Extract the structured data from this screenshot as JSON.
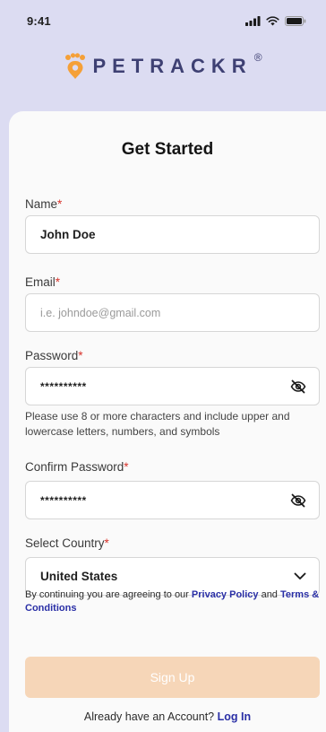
{
  "status_bar": {
    "time": "9:41"
  },
  "brand": {
    "name": "PETRACKR",
    "registered": "®"
  },
  "form": {
    "title": "Get Started",
    "required_mark": "*",
    "name": {
      "label": "Name",
      "value": "John Doe"
    },
    "email": {
      "label": "Email",
      "placeholder": "i.e. johndoe@gmail.com"
    },
    "password": {
      "label": "Password",
      "value": "**********",
      "hint": "Please use 8 or more characters and include upper and lowercase letters, numbers, and symbols"
    },
    "confirm_password": {
      "label": "Confirm Password",
      "value": "**********"
    },
    "country": {
      "label": "Select Country",
      "value": "United States"
    },
    "terms": {
      "prefix": "By continuing you are agreeing to our ",
      "privacy_link": "Privacy Policy",
      "middle": " and ",
      "terms_link": "Terms & Conditions"
    },
    "submit_label": "Sign Up",
    "login_prompt": "Already have an Account? ",
    "login_link": "Log In"
  },
  "colors": {
    "header_bg": "#dcdcf2",
    "brand_text": "#3e4073",
    "brand_icon": "#f5a038",
    "link": "#2a2fa6",
    "required": "#d8342c",
    "button_disabled": "#f6d6b8"
  },
  "icons": {
    "logo": "paw-pin-icon",
    "signal": "signal-icon",
    "wifi": "wifi-icon",
    "battery": "battery-icon",
    "eye_off": "eye-off-icon",
    "dropdown": "chevron-down-icon"
  }
}
